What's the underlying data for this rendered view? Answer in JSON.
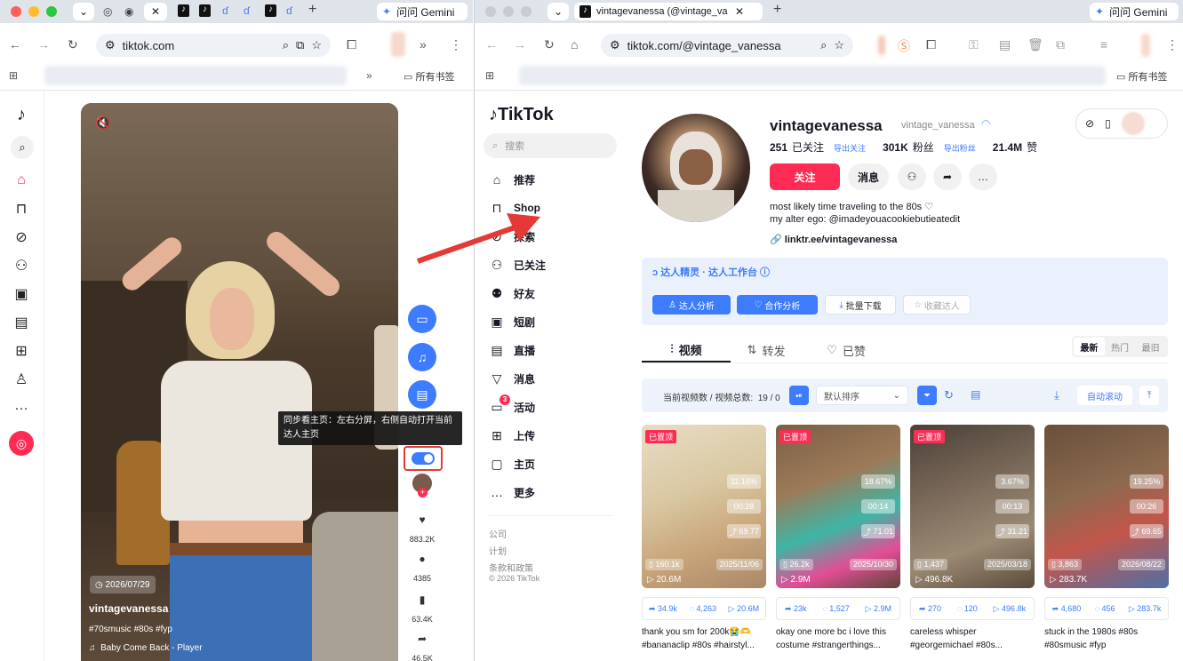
{
  "left_window": {
    "gemini_label": "问问 Gemini",
    "url": "tiktok.com",
    "bookmarks_all": "所有书签",
    "video": {
      "tooltip": "同步看主页：左右分屏，右侧自动打开当前达人主页",
      "date": "2026/07/29",
      "author": "vintagevanessa",
      "hashtags": "#70smusic #80s #fyp",
      "music": "Baby Come Back - Player",
      "likes": "883.2K",
      "comments": "4385",
      "saves": "63.4K",
      "shares": "46.5K"
    }
  },
  "right_window": {
    "tab_title": "vintagevanessa (@vintage_va",
    "gemini_label": "问问 Gemini",
    "url": "tiktok.com/@vintage_vanessa",
    "bookmarks_all": "所有书签",
    "logo_text": "TikTok",
    "search_placeholder": "搜索",
    "nav": [
      {
        "label": "推荐",
        "icon": "home-icon"
      },
      {
        "label": "Shop",
        "icon": "shop-bag-icon"
      },
      {
        "label": "探索",
        "icon": "compass-icon"
      },
      {
        "label": "已关注",
        "icon": "following-icon"
      },
      {
        "label": "好友",
        "icon": "friends-icon"
      },
      {
        "label": "短剧",
        "icon": "drama-icon"
      },
      {
        "label": "直播",
        "icon": "live-icon"
      },
      {
        "label": "消息",
        "icon": "message-icon"
      },
      {
        "label": "活动",
        "icon": "activity-icon",
        "badge": "3"
      },
      {
        "label": "上传",
        "icon": "upload-icon"
      },
      {
        "label": "主页",
        "icon": "profile-icon"
      },
      {
        "label": "更多",
        "icon": "more-icon"
      }
    ],
    "footer": [
      "公司",
      "计划",
      "条款和政策",
      "© 2026 TikTok"
    ],
    "profile": {
      "username": "vintagevanessa",
      "handle": "vintage_vanessa",
      "following_count": "251",
      "following_label": "已关注",
      "export_following": "导出关注",
      "followers_count": "301K",
      "followers_label": "粉丝",
      "export_followers": "导出粉丝",
      "likes_count": "21.4M",
      "likes_label": "赞",
      "follow_button": "关注",
      "message_button": "消息",
      "bio_line1": "most likely time traveling to the 80s ♡",
      "bio_line2": "my alter ego: @imadeyouacookiebutieatedit",
      "link": "linktr.ee/vintagevanessa"
    },
    "plugin": {
      "title": "达人精灵 · 达人工作台",
      "btn_analysis": "达人分析",
      "btn_coop": "合作分析",
      "btn_download": "批量下载",
      "btn_collect": "收藏达人"
    },
    "tabs": {
      "videos": "视频",
      "reposts": "转发",
      "liked": "已赞"
    },
    "sort_tabs": [
      "最新",
      "热门",
      "最旧"
    ],
    "filter_bar": {
      "label": "当前视频数 / 视频总数:",
      "value": "19 / 0",
      "sort_select": "默认排序",
      "auto_scroll": "自动滚动"
    },
    "cards": [
      {
        "badge": "已置顶",
        "rate": "11.16%",
        "duration": "00:28",
        "trend": "69.77",
        "saves": "160.1k",
        "date": "2025/11/06",
        "plays": "20.6M",
        "shares": "34.9k",
        "comments": "4,263",
        "views": "20.6M",
        "caption": "thank you sm for 200k😭🫶 #bananaclip #80s #hairstyl..."
      },
      {
        "badge": "已置顶",
        "rate": "18.67%",
        "duration": "00:14",
        "trend": "71.01",
        "saves": "26.2k",
        "date": "2025/10/30",
        "plays": "2.9M",
        "shares": "23k",
        "comments": "1,527",
        "views": "2.9M",
        "caption": "okay one more bc i love this costume #strangerthings..."
      },
      {
        "badge": "已置顶",
        "rate": "3.67%",
        "duration": "00:13",
        "trend": "31.21",
        "saves": "1,437",
        "date": "2025/03/18",
        "plays": "496.8K",
        "shares": "270",
        "comments": "120",
        "views": "496.8k",
        "caption": "careless whisper #georgemichael #80s..."
      },
      {
        "badge": "",
        "rate": "19.25%",
        "duration": "00:26",
        "trend": "69.65",
        "saves": "3,863",
        "date": "2026/08/22",
        "plays": "283.7K",
        "shares": "4,680",
        "comments": "456",
        "views": "283.7k",
        "caption": "stuck in the 1980s #80s #80smusic #fyp"
      }
    ]
  }
}
